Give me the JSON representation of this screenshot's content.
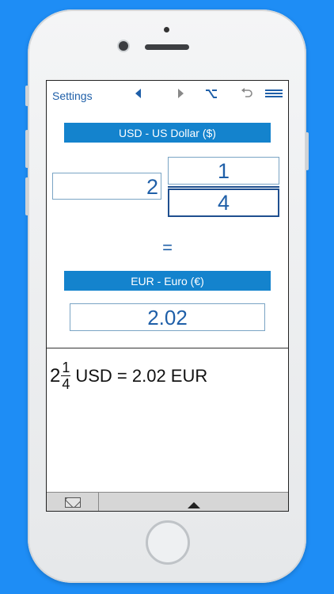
{
  "toolbar": {
    "settings_label": "Settings",
    "icons": [
      "back-arrow-icon",
      "forward-arrow-icon",
      "option-key-icon",
      "undo-icon",
      "menu-icon"
    ]
  },
  "from_currency": {
    "label": "USD - US Dollar ($)"
  },
  "input": {
    "whole": "2",
    "numerator": "1",
    "denominator": "4"
  },
  "equals_sign": "=",
  "to_currency": {
    "label": "EUR - Euro (€)"
  },
  "result": {
    "value": "2.02"
  },
  "result_line": {
    "whole": "2",
    "numerator": "1",
    "denominator": "4",
    "text": "USD = 2.02 EUR"
  },
  "colors": {
    "background": "#1e8df5",
    "currency_bar": "#1483cd",
    "accent_text": "#1f5fa8"
  }
}
